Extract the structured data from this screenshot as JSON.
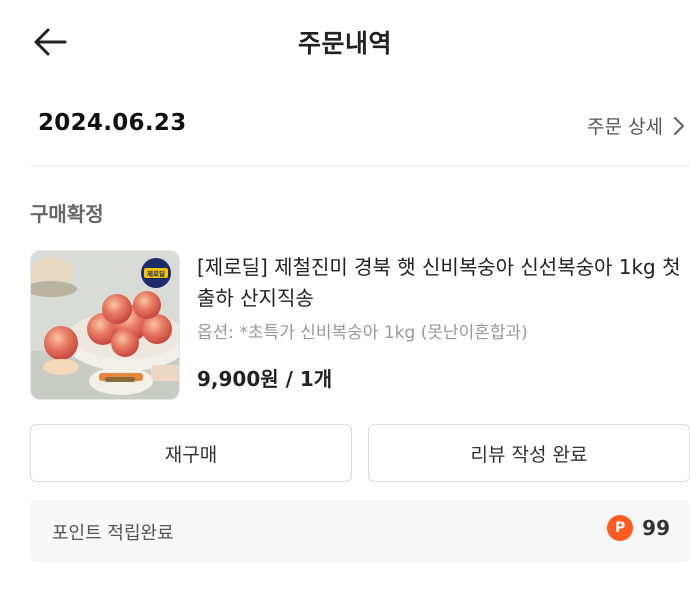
{
  "header": {
    "title": "주문내역",
    "back_icon": "arrow-left-icon"
  },
  "order": {
    "date": "2024.06.23",
    "detail_label": "주문 상세",
    "detail_icon": "chevron-right-icon"
  },
  "status": {
    "label": "구매확정"
  },
  "product": {
    "name": "[제로딜] 제철진미 경북 햇 신비복숭아 신선복숭아 1kg 첫 출하 산지직송",
    "option": "옵션: *초특가 신비복숭아 1kg (못난이혼합과)",
    "price": "9,900원 / 1개",
    "thumbnail_badge_text": "제로딜"
  },
  "actions": {
    "rebuy_label": "재구매",
    "review_label": "리뷰 작성 완료"
  },
  "points": {
    "label": "포인트 적립완료",
    "badge": "P",
    "value": "99",
    "badge_color": "#ff5a1f"
  }
}
